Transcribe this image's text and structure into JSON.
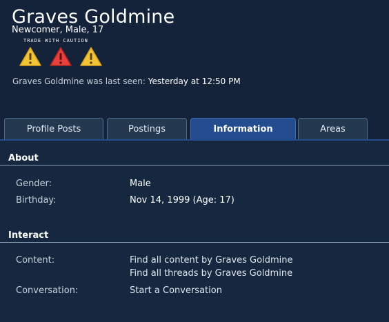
{
  "profile": {
    "username": "Graves Goldmine",
    "user_title": "Newcomer, Male, 17",
    "trade_warning_label": "TRADE WITH CAUTION",
    "last_seen_prefix": "Graves Goldmine was last seen:",
    "last_seen_time": "Yesterday at 12:50 PM",
    "warning_icons": [
      {
        "name": "warning-yellow-icon",
        "color": "#f2c332"
      },
      {
        "name": "warning-red-icon",
        "color": "#e8403c"
      },
      {
        "name": "warning-yellow-icon",
        "color": "#f2c332"
      }
    ]
  },
  "tabs": [
    {
      "label": "Profile Posts",
      "active": false
    },
    {
      "label": "Postings",
      "active": false
    },
    {
      "label": "Information",
      "active": true
    },
    {
      "label": "Areas",
      "active": false
    }
  ],
  "about": {
    "heading": "About",
    "gender_label": "Gender:",
    "gender_value": "Male",
    "birthday_label": "Birthday:",
    "birthday_value": "Nov 14, 1999 (Age: 17)"
  },
  "interact": {
    "heading": "Interact",
    "content_label": "Content:",
    "content_link_1": "Find all content by Graves Goldmine",
    "content_link_2": "Find all threads by Graves Goldmine",
    "conversation_label": "Conversation:",
    "conversation_link": "Start a Conversation"
  },
  "colors": {
    "background": "#16283f",
    "active_tab": "#234d8f",
    "inactive_tab": "#24384f"
  }
}
